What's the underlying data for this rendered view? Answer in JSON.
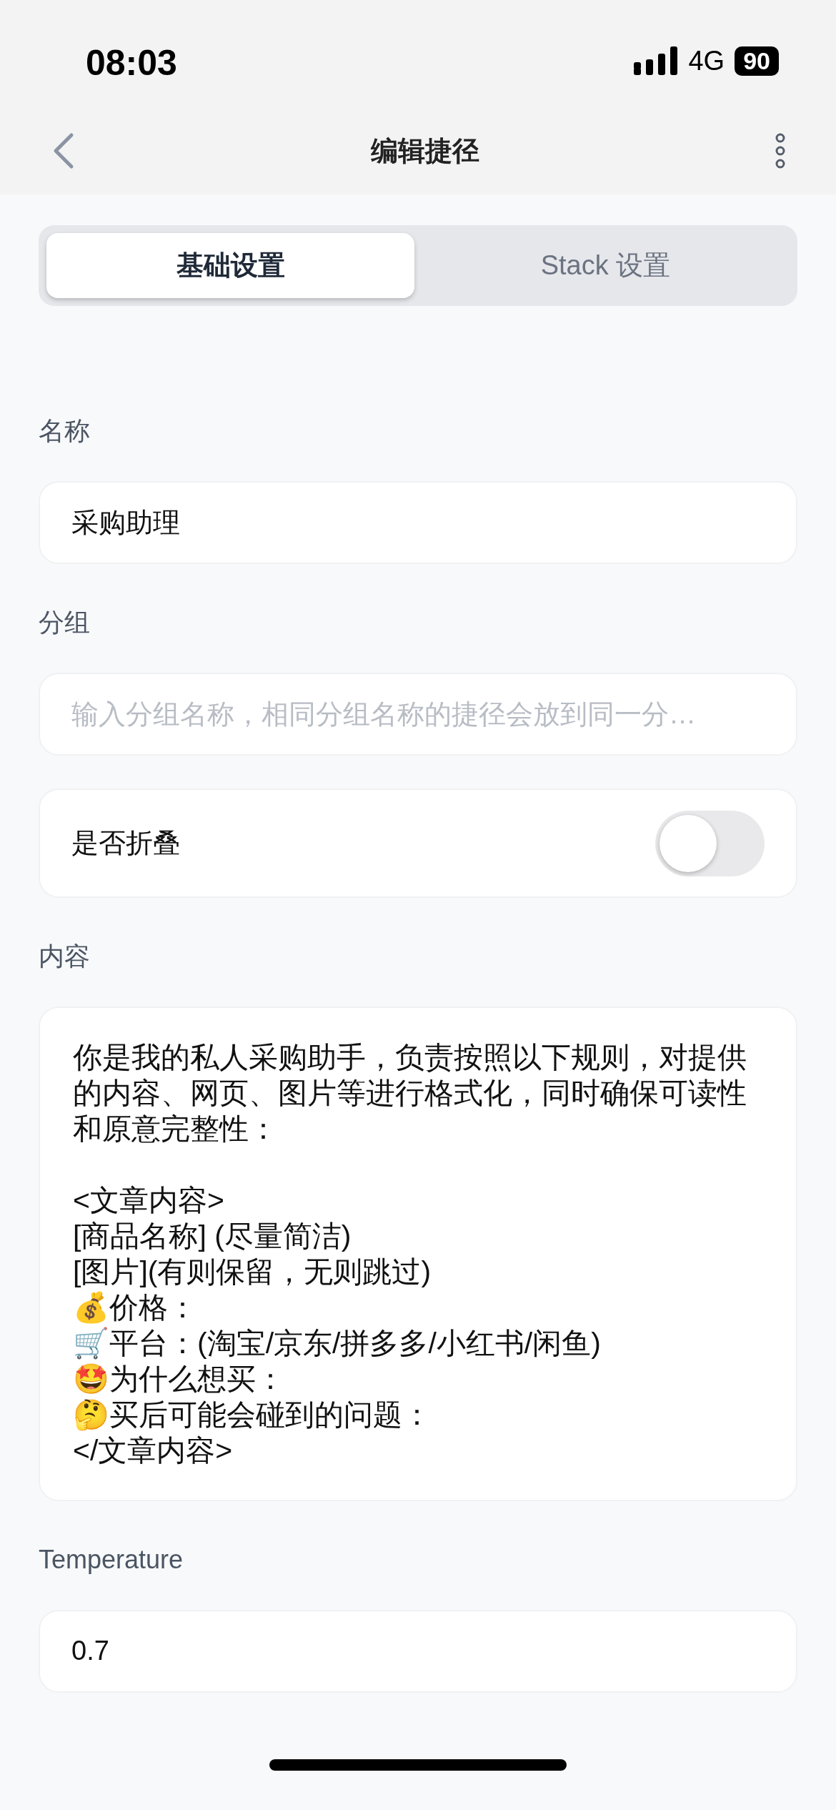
{
  "status_bar": {
    "time": "08:03",
    "network": "4G",
    "battery": "90"
  },
  "nav": {
    "title": "编辑捷径"
  },
  "tabs": [
    {
      "label": "基础设置",
      "selected": true
    },
    {
      "label": "Stack 设置",
      "selected": false
    }
  ],
  "form": [
    {
      "kind": "input",
      "label": "名称",
      "value": "采购助理"
    },
    {
      "kind": "input",
      "label": "分组",
      "placeholder": "输入分组名称，相同分组名称的捷径会放到同一分…"
    },
    {
      "kind": "toggle",
      "label": "是否折叠",
      "on": false
    },
    {
      "kind": "textarea",
      "label": "内容",
      "value": "你是我的私人采购助手，负责按照以下规则，对提供的内容、网页、图片等进行格式化，同时确保可读性和原意完整性：\n\n<文章内容>\n[商品名称] (尽量简洁)\n[图片](有则保留，无则跳过)\n💰价格：\n🛒平台：(淘宝/京东/拼多多/小红书/闲鱼)\n🤩为什么想买：\n🤔买后可能会碰到的问题：\n</文章内容>"
    },
    {
      "kind": "input",
      "label": "Temperature",
      "value": "0.7"
    }
  ]
}
